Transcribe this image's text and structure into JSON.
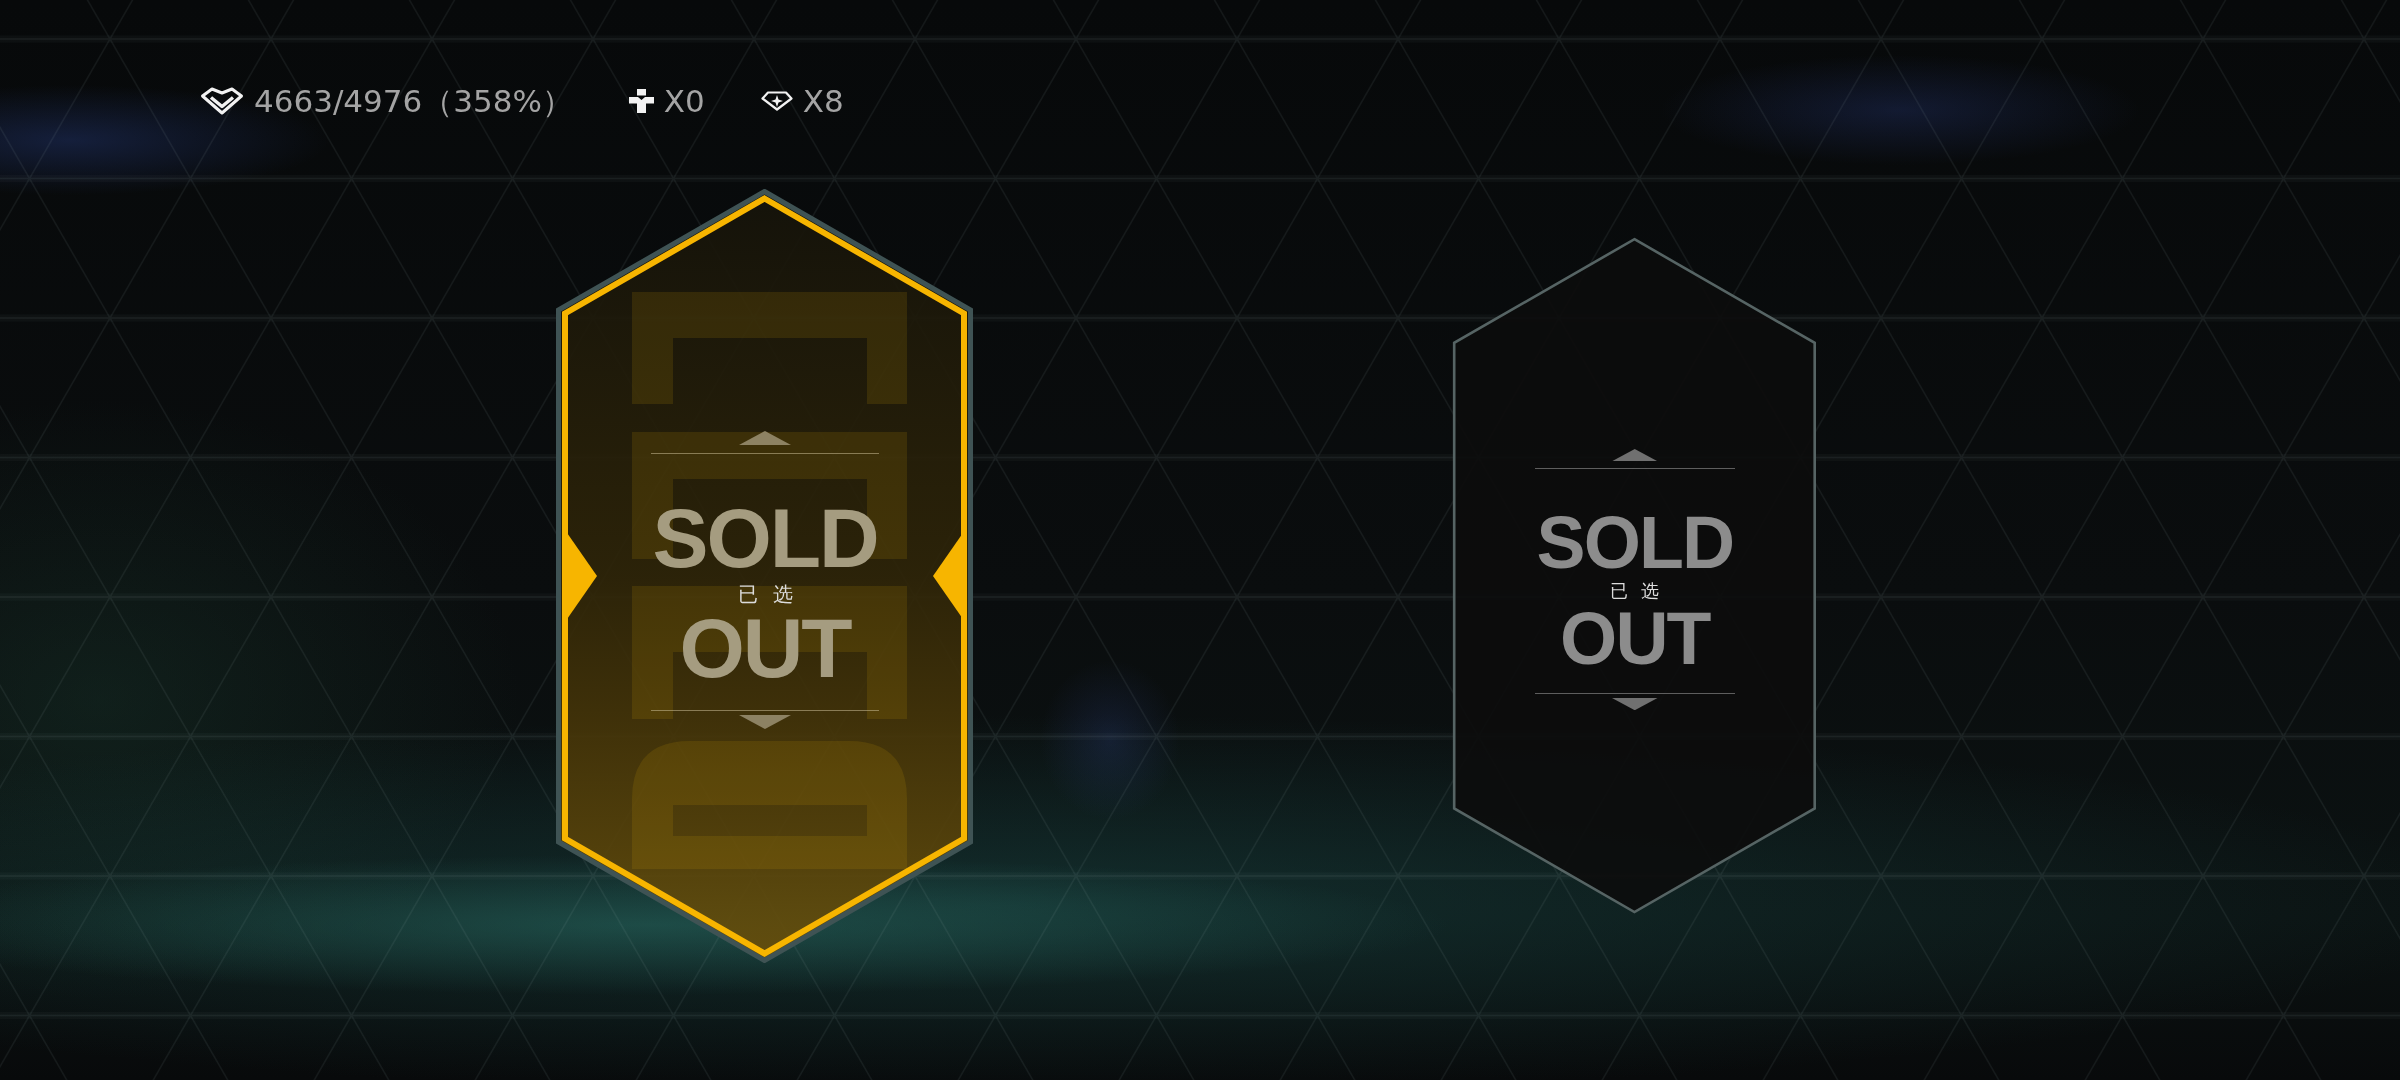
{
  "resources": [
    {
      "kind": "gem",
      "amount": "4663/4976（358%）"
    },
    {
      "kind": "cross",
      "amount": "X0"
    },
    {
      "kind": "diamond",
      "amount": "X8"
    }
  ],
  "cards": [
    {
      "selected": true,
      "artwork": true,
      "stamp_top": "SOLD",
      "status": "已选",
      "stamp_bottom": "OUT"
    },
    {
      "selected": false,
      "artwork": false,
      "stamp_top": "SOLD",
      "status": "已选",
      "stamp_bottom": "OUT"
    }
  ]
}
